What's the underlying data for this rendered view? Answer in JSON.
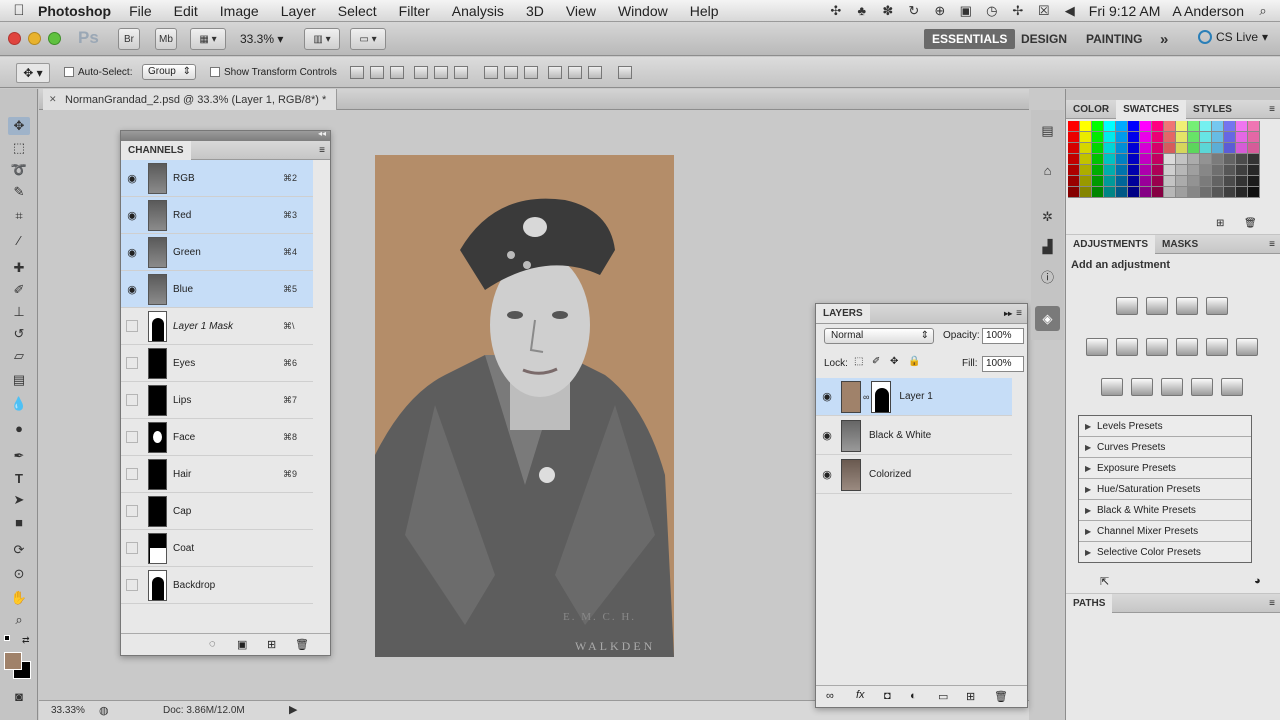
{
  "menubar": {
    "app_name": "Photoshop",
    "items": [
      "File",
      "Edit",
      "Image",
      "Layer",
      "Select",
      "Filter",
      "Analysis",
      "3D",
      "View",
      "Window",
      "Help"
    ],
    "clock": "Fri 9:12 AM",
    "user": "A Anderson"
  },
  "appbar": {
    "logo": "Ps",
    "bridge_label": "Br",
    "minibridge_label": "Mb",
    "zoom": "33.3%",
    "workspaces": [
      "ESSENTIALS",
      "DESIGN",
      "PAINTING"
    ],
    "more": "»",
    "cslive": "CS Live"
  },
  "options": {
    "auto_select_label": "Auto-Select:",
    "auto_select_value": "Group",
    "show_transform_label": "Show Transform Controls"
  },
  "document": {
    "tab_title": "NormanGrandad_2.psd @ 33.3% (Layer 1, RGB/8*) *",
    "status_zoom": "33.33%",
    "status_doc": "Doc: 3.86M/12.0M"
  },
  "channels": {
    "title": "CHANNELS",
    "rows": [
      {
        "name": "RGB",
        "key": "⌘2",
        "visible": true,
        "selected": true,
        "thumb": "photo"
      },
      {
        "name": "Red",
        "key": "⌘3",
        "visible": true,
        "selected": true,
        "thumb": "photo"
      },
      {
        "name": "Green",
        "key": "⌘4",
        "visible": true,
        "selected": true,
        "thumb": "photo"
      },
      {
        "name": "Blue",
        "key": "⌘5",
        "visible": true,
        "selected": true,
        "thumb": "photo"
      },
      {
        "name": "Layer 1 Mask",
        "key": "⌘\\",
        "visible": false,
        "selected": false,
        "thumb": "silhouette"
      },
      {
        "name": "Eyes",
        "key": "⌘6",
        "visible": false,
        "selected": false,
        "thumb": "black"
      },
      {
        "name": "Lips",
        "key": "⌘7",
        "visible": false,
        "selected": false,
        "thumb": "black"
      },
      {
        "name": "Face",
        "key": "⌘8",
        "visible": false,
        "selected": false,
        "thumb": "face"
      },
      {
        "name": "Hair",
        "key": "⌘9",
        "visible": false,
        "selected": false,
        "thumb": "black"
      },
      {
        "name": "Cap",
        "key": "",
        "visible": false,
        "selected": false,
        "thumb": "black"
      },
      {
        "name": "Coat",
        "key": "",
        "visible": false,
        "selected": false,
        "thumb": "coat"
      },
      {
        "name": "Backdrop",
        "key": "",
        "visible": false,
        "selected": false,
        "thumb": "silhouette"
      }
    ]
  },
  "layers": {
    "title": "LAYERS",
    "blend_mode": "Normal",
    "opacity_label": "Opacity:",
    "opacity_value": "100%",
    "lock_label": "Lock:",
    "fill_label": "Fill:",
    "fill_value": "100%",
    "rows": [
      {
        "name": "Layer 1",
        "selected": true
      },
      {
        "name": "Black & White",
        "selected": false
      },
      {
        "name": "Colorized",
        "selected": false
      }
    ]
  },
  "color_panel": {
    "tabs": [
      "COLOR",
      "SWATCHES",
      "STYLES"
    ]
  },
  "adjustments": {
    "tabs": [
      "ADJUSTMENTS",
      "MASKS"
    ],
    "heading": "Add an adjustment",
    "presets": [
      "Levels Presets",
      "Curves Presets",
      "Exposure Presets",
      "Hue/Saturation Presets",
      "Black & White Presets",
      "Channel Mixer Presets",
      "Selective Color Presets"
    ]
  },
  "paths": {
    "title": "PATHS"
  },
  "colors": {
    "photo_bg": "#b48d69",
    "selection": "#c6ddf7",
    "foreground": "#a0826a"
  }
}
